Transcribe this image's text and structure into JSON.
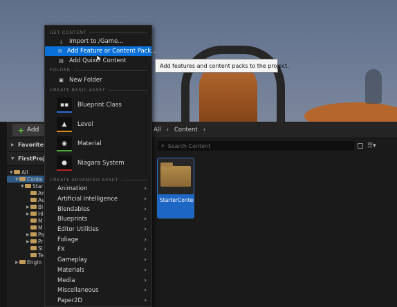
{
  "toolbar": {
    "add_label": "Add"
  },
  "breadcrumb": {
    "items": [
      "All",
      "Content"
    ]
  },
  "left_panel": {
    "favorites_label": "Favorites",
    "project_label": "FirstProje",
    "tree": [
      {
        "label": "All",
        "indent": 0,
        "expanded": true
      },
      {
        "label": "Conte",
        "indent": 1,
        "expanded": true,
        "selected": true
      },
      {
        "label": "Star",
        "indent": 2,
        "expanded": true
      },
      {
        "label": "An",
        "indent": 3
      },
      {
        "label": "Au",
        "indent": 3
      },
      {
        "label": "Bl",
        "indent": 3,
        "has_children": true
      },
      {
        "label": "HI",
        "indent": 3,
        "has_children": true
      },
      {
        "label": "M",
        "indent": 3
      },
      {
        "label": "M",
        "indent": 3
      },
      {
        "label": "Pa",
        "indent": 3,
        "has_children": true
      },
      {
        "label": "Pr",
        "indent": 3,
        "has_children": true
      },
      {
        "label": "Sl",
        "indent": 3
      },
      {
        "label": "Te",
        "indent": 3
      },
      {
        "label": "Engin",
        "indent": 1,
        "has_children": true
      }
    ]
  },
  "search": {
    "placeholder": "Search Content"
  },
  "asset_tile": {
    "name": "StarterContent"
  },
  "context_menu": {
    "get_content_header": "GET CONTENT",
    "get_content_items": [
      {
        "label": "Import to /Game...",
        "icon": "import-icon"
      },
      {
        "label": "Add Feature or Content Pack...",
        "icon": "add-feature-icon",
        "highlighted": true
      },
      {
        "label": "Add Quixel Content",
        "icon": "quixel-icon"
      }
    ],
    "folder_header": "FOLDER",
    "new_folder_label": "New Folder",
    "basic_asset_header": "CREATE BASIC ASSET",
    "basic_assets": [
      {
        "label": "Blueprint Class",
        "icon": "blueprint-class-icon",
        "color": "#2f6bd6"
      },
      {
        "label": "Level",
        "icon": "level-icon",
        "color": "#e08a1e"
      },
      {
        "label": "Material",
        "icon": "material-icon",
        "color": "#4fa83a"
      },
      {
        "label": "Niagara System",
        "icon": "niagara-system-icon",
        "color": "#b32424"
      }
    ],
    "advanced_asset_header": "CREATE ADVANCED ASSET",
    "advanced_assets": [
      "Animation",
      "Artificial Intelligence",
      "Blendables",
      "Blueprints",
      "Editor Utilities",
      "Foliage",
      "FX",
      "Gameplay",
      "Materials",
      "Media",
      "Miscellaneous",
      "Paper2D"
    ]
  },
  "tooltip": {
    "text": "Add features and content packs to the project."
  },
  "colors": {
    "highlight": "#0a70d9",
    "selection": "#1e66c4",
    "folder": "#c09b5a"
  }
}
